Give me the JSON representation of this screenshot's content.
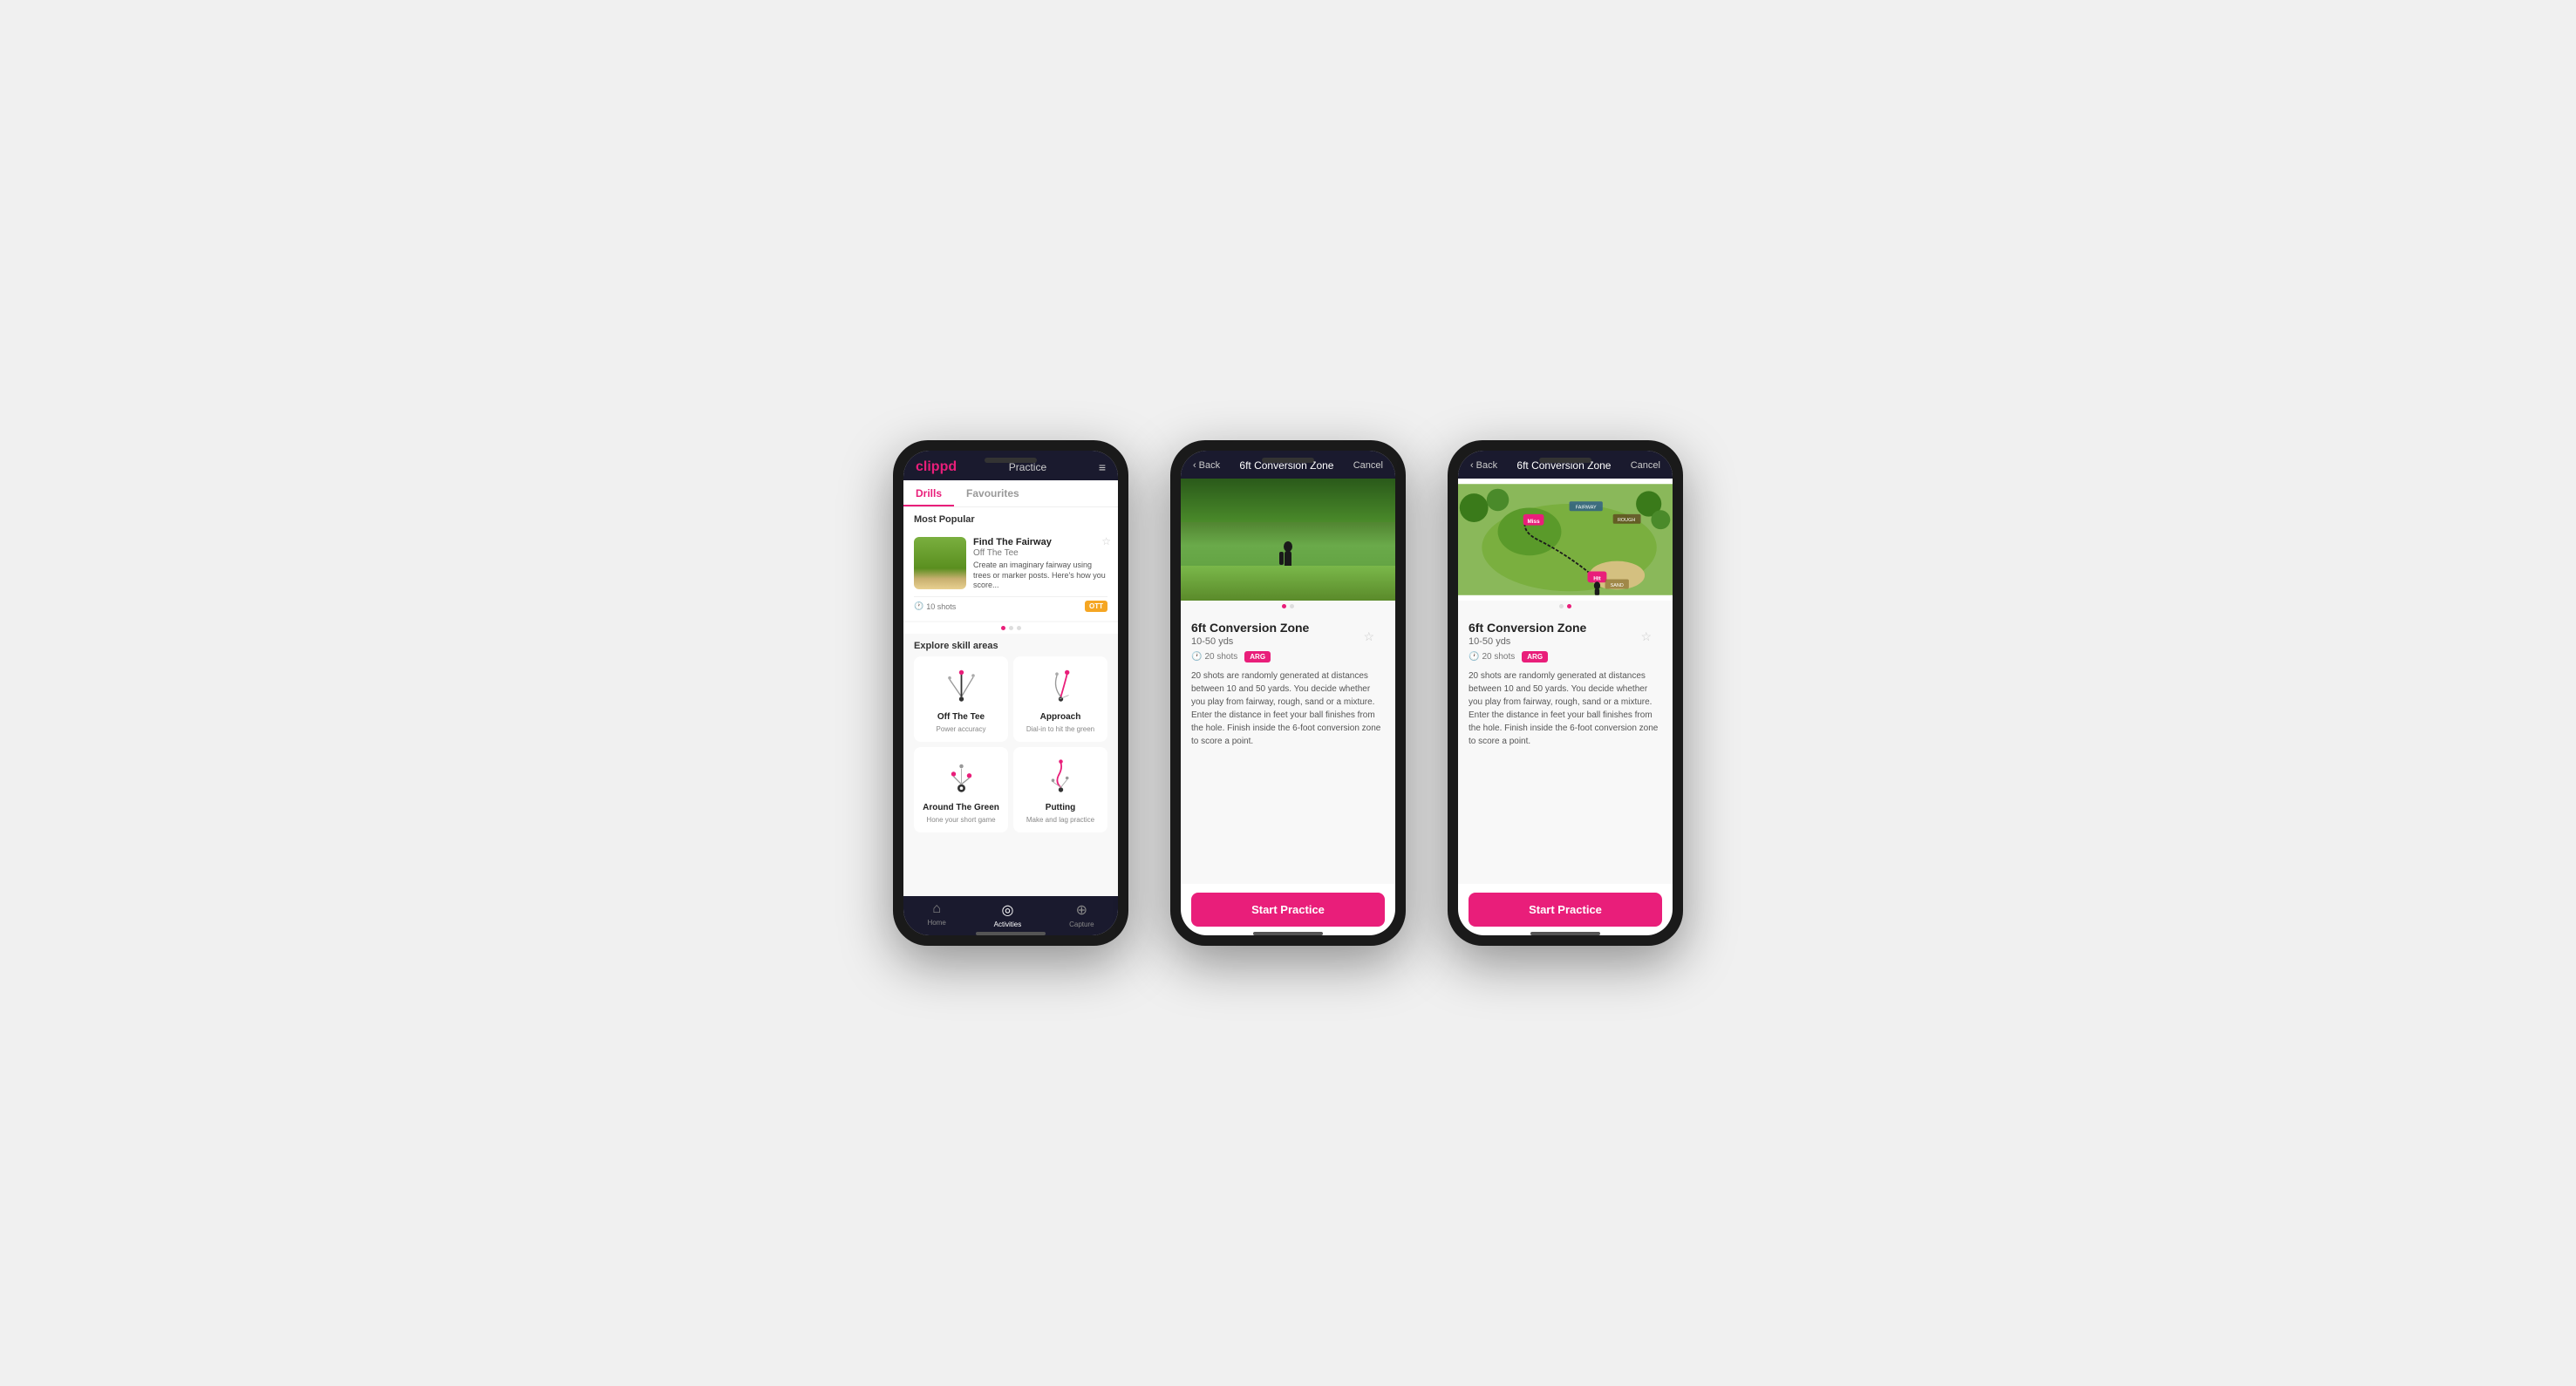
{
  "phone1": {
    "header": {
      "logo": "clippd",
      "title": "Practice",
      "menu_icon": "≡"
    },
    "tabs": [
      {
        "label": "Drills",
        "active": true
      },
      {
        "label": "Favourites",
        "active": false
      }
    ],
    "most_popular_label": "Most Popular",
    "featured_drill": {
      "title": "Find The Fairway",
      "subtitle": "Off The Tee",
      "description": "Create an imaginary fairway using trees or marker posts. Here's how you score...",
      "shots": "10 shots",
      "tag": "OTT"
    },
    "explore_label": "Explore skill areas",
    "skill_areas": [
      {
        "name": "Off The Tee",
        "desc": "Power accuracy"
      },
      {
        "name": "Approach",
        "desc": "Dial-in to hit the green"
      },
      {
        "name": "Around The Green",
        "desc": "Hone your short game"
      },
      {
        "name": "Putting",
        "desc": "Make and lag practice"
      }
    ],
    "bottom_nav": [
      {
        "label": "Home",
        "icon": "⌂",
        "active": false
      },
      {
        "label": "Activities",
        "icon": "◎",
        "active": true
      },
      {
        "label": "Capture",
        "icon": "⊕",
        "active": false
      }
    ]
  },
  "phone2": {
    "header": {
      "back": "Back",
      "title": "6ft Conversion Zone",
      "cancel": "Cancel"
    },
    "image_type": "photo",
    "drill": {
      "name": "6ft Conversion Zone",
      "yardage": "10-50 yds",
      "shots": "20 shots",
      "tag": "ARG",
      "description": "20 shots are randomly generated at distances between 10 and 50 yards. You decide whether you play from fairway, rough, sand or a mixture. Enter the distance in feet your ball finishes from the hole. Finish inside the 6-foot conversion zone to score a point."
    },
    "start_btn": "Start Practice"
  },
  "phone3": {
    "header": {
      "back": "Back",
      "title": "6ft Conversion Zone",
      "cancel": "Cancel"
    },
    "image_type": "map",
    "drill": {
      "name": "6ft Conversion Zone",
      "yardage": "10-50 yds",
      "shots": "20 shots",
      "tag": "ARG",
      "description": "20 shots are randomly generated at distances between 10 and 50 yards. You decide whether you play from fairway, rough, sand or a mixture. Enter the distance in feet your ball finishes from the hole. Finish inside the 6-foot conversion zone to score a point."
    },
    "start_btn": "Start Practice"
  }
}
